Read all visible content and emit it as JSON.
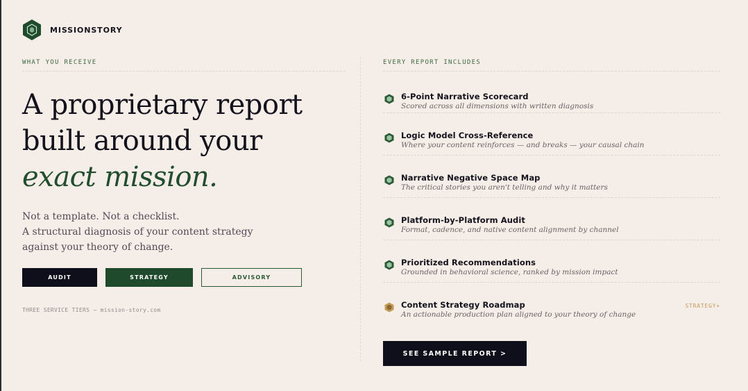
{
  "brand": {
    "name": "MISSIONSTORY",
    "logo_icon": "hexagon-logo-icon",
    "color": "#1f4a2b"
  },
  "left": {
    "eyebrow": "WHAT YOU RECEIVE",
    "headline": {
      "line1": "A proprietary report",
      "line2": "built around your",
      "accent": "exact mission."
    },
    "lede": [
      "Not a template. Not a checklist.",
      "A structural diagnosis of your content strategy",
      "against your theory of change."
    ],
    "tiers": [
      "AUDIT",
      "STRATEGY",
      "ADVISORY"
    ],
    "footnote": "THREE SERVICE TIERS — mission-story.com"
  },
  "right": {
    "eyebrow": "EVERY REPORT INCLUDES",
    "items": [
      {
        "title": "6-Point Narrative Scorecard",
        "desc": "Scored across all dimensions with written diagnosis",
        "icon": "hexagon-bullet-icon",
        "tag": ""
      },
      {
        "title": "Logic Model Cross-Reference",
        "desc": "Where your content reinforces — and breaks — your causal chain",
        "icon": "hexagon-bullet-icon",
        "tag": ""
      },
      {
        "title": "Narrative Negative Space Map",
        "desc": "The critical stories you aren't telling and why it matters",
        "icon": "hexagon-bullet-icon",
        "tag": ""
      },
      {
        "title": "Platform-by-Platform Audit",
        "desc": "Format, cadence, and native content alignment by channel",
        "icon": "hexagon-bullet-icon",
        "tag": ""
      },
      {
        "title": "Prioritized Recommendations",
        "desc": "Grounded in behavioral science, ranked by mission impact",
        "icon": "hexagon-bullet-icon",
        "tag": ""
      },
      {
        "title": "Content Strategy Roadmap",
        "desc": "An actionable production plan aligned to your theory of change",
        "icon": "gold-hexagon-bullet-icon",
        "tag": "STRATEGY+"
      }
    ],
    "cta": "SEE SAMPLE REPORT >"
  },
  "colors": {
    "background": "#f5ede7",
    "ink": "#14121c",
    "green": "#1f4a2b",
    "accent_green": "#3c6a44",
    "gold": "#c49b59"
  }
}
